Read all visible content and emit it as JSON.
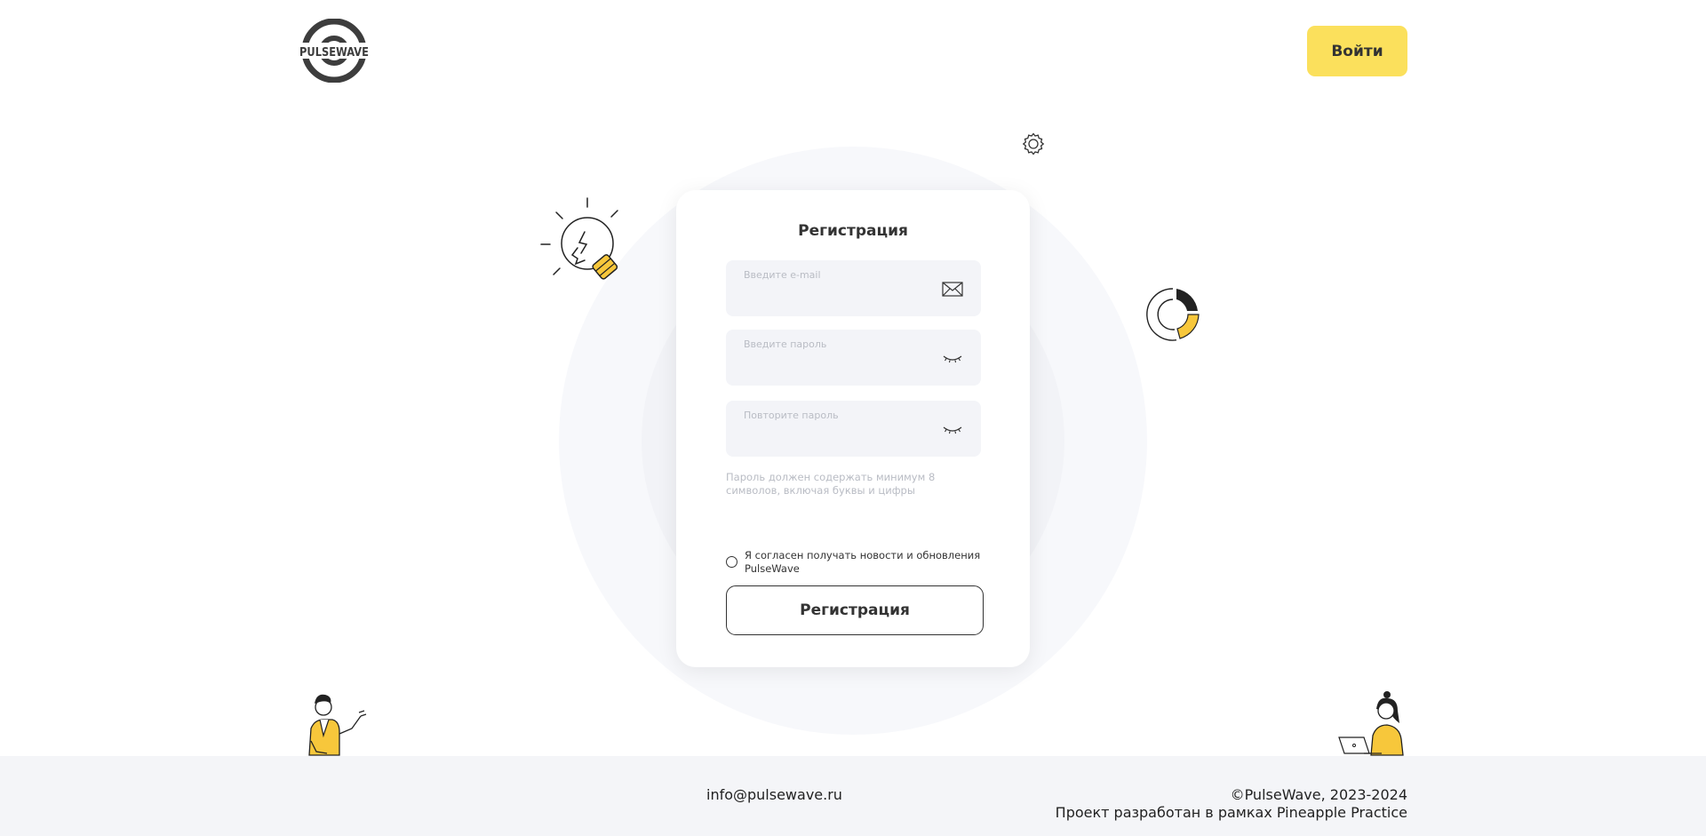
{
  "header": {
    "logo_text": "PULSEWAVE",
    "login_label": "Войти"
  },
  "form": {
    "title": "Регистрация",
    "email": {
      "placeholder": "Введите e-mail",
      "value": "",
      "icon": "envelope-icon"
    },
    "password": {
      "placeholder": "Введите пароль",
      "value": "",
      "icon": "eye-closed-icon"
    },
    "password_repeat": {
      "placeholder": "Повторите пароль",
      "value": "",
      "icon": "eye-closed-icon"
    },
    "hint": "Пароль должен содержать минимум 8 символов, включая буквы и цифры",
    "consent_label": "Я согласен получать новости и обновления PulseWave",
    "consent_checked": false,
    "submit_label": "Регистрация"
  },
  "footer": {
    "email": "info@pulsewave.ru",
    "copyright": "©PulseWave, 2023-2024",
    "project_note": "Проект разработан в рамках Pineapple Practice"
  },
  "colors": {
    "accent": "#fbe05c",
    "text": "#333333",
    "field_bg": "#f3f4f8",
    "footer_bg": "#f4f5f8"
  }
}
